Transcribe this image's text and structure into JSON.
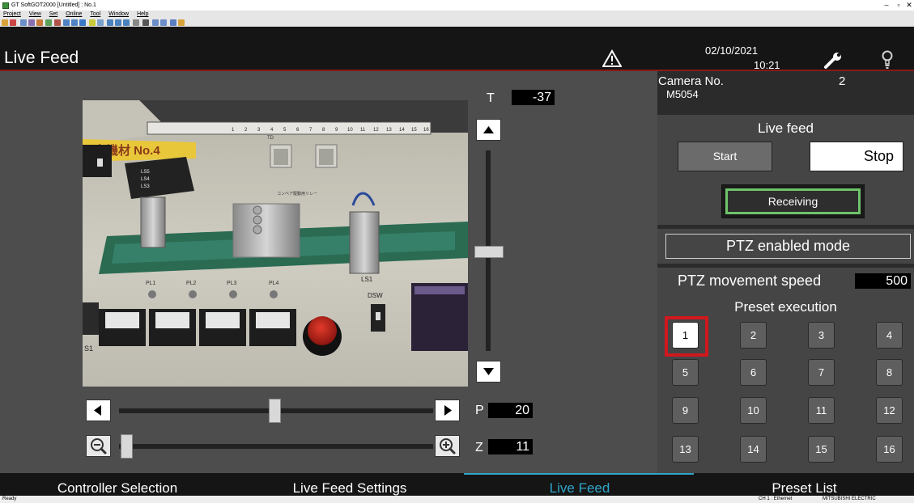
{
  "window": {
    "title": "GT SoftGOT2000 [Untitled] : No.1",
    "minimize": "–",
    "maximize": "▫",
    "close": "✕"
  },
  "menu": [
    "Project",
    "View",
    "Set",
    "Online",
    "Tool",
    "Window",
    "Help"
  ],
  "header": {
    "title": "Live Feed",
    "date": "02/10/2021",
    "time": "10:21",
    "icons": [
      "warning-icon",
      "wrench-icon",
      "lightbulb-icon"
    ]
  },
  "camera_controls": {
    "tilt": {
      "label": "T",
      "value": "-37"
    },
    "pan": {
      "label": "P",
      "value": "20"
    },
    "zoom": {
      "label": "Z",
      "value": "11"
    }
  },
  "camera_image": {
    "plate_text": "定機材 No.4",
    "label_td": "TD",
    "relay_label": "コンベア駆動用リレー",
    "switch_labels": [
      "LS5",
      "LS4",
      "LS3"
    ],
    "pl_labels": [
      "PL1",
      "PL2",
      "PL3",
      "PL4"
    ],
    "ls1": "LS1",
    "dsw": "DSW",
    "s1": "S1",
    "terminal_numbers": [
      "1",
      "2",
      "3",
      "4",
      "5",
      "6",
      "7",
      "8",
      "9",
      "10",
      "11",
      "12",
      "13",
      "14",
      "15",
      "16"
    ]
  },
  "side": {
    "camera_no_label": "Camera No.",
    "camera_no_value": "2",
    "camera_model": "M5054",
    "live_feed_title": "Live feed",
    "start_label": "Start",
    "stop_label": "Stop",
    "receiving_label": "Receiving",
    "ptz_mode_label": "PTZ enabled mode",
    "ptz_speed_label": "PTZ movement speed",
    "ptz_speed_value": "500",
    "preset_title": "Preset execution",
    "presets": [
      "1",
      "2",
      "3",
      "4",
      "5",
      "6",
      "7",
      "8",
      "9",
      "10",
      "11",
      "12",
      "13",
      "14",
      "15",
      "16"
    ],
    "selected_preset": "1"
  },
  "tabs": [
    {
      "label": "Controller Selection",
      "active": false
    },
    {
      "label": "Live Feed Settings",
      "active": false
    },
    {
      "label": "Live Feed",
      "active": true
    },
    {
      "label": "Preset List",
      "active": false
    }
  ],
  "status": {
    "left": "Ready",
    "connection": "CH 1 : Ethernet",
    "vendor": "MITSUBISHI ELECTRIC"
  },
  "colors": {
    "accent_tab": "#2fa5c8",
    "tab_active_text": "#2fa5c8",
    "receiving_border": "#6fc36a",
    "selected_preset_border": "#d0181e"
  }
}
